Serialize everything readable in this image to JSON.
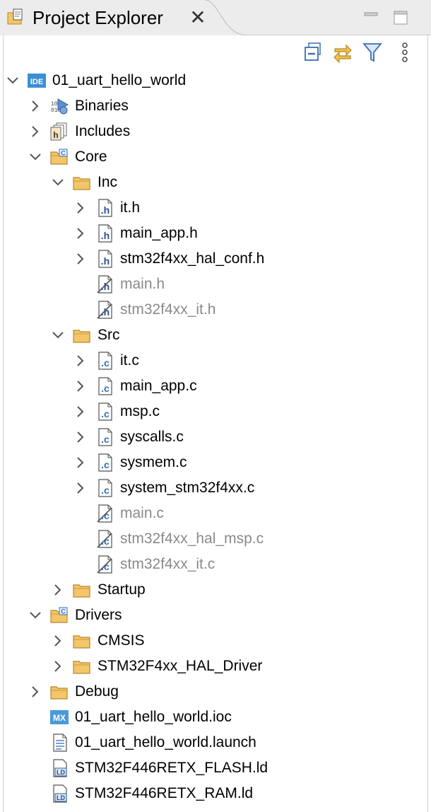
{
  "view": {
    "title": "Project Explorer",
    "close_glyph": "✕"
  },
  "toolbar": {
    "buttons": [
      "collapse-all-icon",
      "link-with-editor-icon",
      "filter-icon",
      "view-menu-icon"
    ]
  },
  "tree": [
    {
      "label": "01_uart_hello_world",
      "depth": 0,
      "chevron": "down",
      "icon": "ide-project",
      "dim": false
    },
    {
      "label": "Binaries",
      "depth": 1,
      "chevron": "right",
      "icon": "binaries",
      "dim": false
    },
    {
      "label": "Includes",
      "depth": 1,
      "chevron": "right",
      "icon": "includes",
      "dim": false
    },
    {
      "label": "Core",
      "depth": 1,
      "chevron": "down",
      "icon": "source-folder",
      "dim": false
    },
    {
      "label": "Inc",
      "depth": 2,
      "chevron": "down",
      "icon": "folder",
      "dim": false
    },
    {
      "label": "it.h",
      "depth": 3,
      "chevron": "right",
      "icon": "h-file",
      "dim": false
    },
    {
      "label": "main_app.h",
      "depth": 3,
      "chevron": "right",
      "icon": "h-file",
      "dim": false
    },
    {
      "label": "stm32f4xx_hal_conf.h",
      "depth": 3,
      "chevron": "right",
      "icon": "h-file",
      "dim": false
    },
    {
      "label": "main.h",
      "depth": 3,
      "chevron": "none",
      "icon": "h-file-excluded",
      "dim": true
    },
    {
      "label": "stm32f4xx_it.h",
      "depth": 3,
      "chevron": "none",
      "icon": "h-file-excluded",
      "dim": true
    },
    {
      "label": "Src",
      "depth": 2,
      "chevron": "down",
      "icon": "folder",
      "dim": false
    },
    {
      "label": "it.c",
      "depth": 3,
      "chevron": "right",
      "icon": "c-file",
      "dim": false
    },
    {
      "label": "main_app.c",
      "depth": 3,
      "chevron": "right",
      "icon": "c-file",
      "dim": false
    },
    {
      "label": "msp.c",
      "depth": 3,
      "chevron": "right",
      "icon": "c-file",
      "dim": false
    },
    {
      "label": "syscalls.c",
      "depth": 3,
      "chevron": "right",
      "icon": "c-file",
      "dim": false
    },
    {
      "label": "sysmem.c",
      "depth": 3,
      "chevron": "right",
      "icon": "c-file",
      "dim": false
    },
    {
      "label": "system_stm32f4xx.c",
      "depth": 3,
      "chevron": "right",
      "icon": "c-file",
      "dim": false
    },
    {
      "label": "main.c",
      "depth": 3,
      "chevron": "none",
      "icon": "c-file-excluded",
      "dim": true
    },
    {
      "label": "stm32f4xx_hal_msp.c",
      "depth": 3,
      "chevron": "none",
      "icon": "c-file-excluded",
      "dim": true
    },
    {
      "label": "stm32f4xx_it.c",
      "depth": 3,
      "chevron": "none",
      "icon": "c-file-excluded",
      "dim": true
    },
    {
      "label": "Startup",
      "depth": 2,
      "chevron": "right",
      "icon": "folder",
      "dim": false
    },
    {
      "label": "Drivers",
      "depth": 1,
      "chevron": "down",
      "icon": "source-folder",
      "dim": false
    },
    {
      "label": "CMSIS",
      "depth": 2,
      "chevron": "right",
      "icon": "folder",
      "dim": false
    },
    {
      "label": "STM32F4xx_HAL_Driver",
      "depth": 2,
      "chevron": "right",
      "icon": "folder",
      "dim": false
    },
    {
      "label": "Debug",
      "depth": 1,
      "chevron": "right",
      "icon": "folder",
      "dim": false
    },
    {
      "label": "01_uart_hello_world.ioc",
      "depth": 1,
      "chevron": "none",
      "icon": "mx-file",
      "dim": false
    },
    {
      "label": "01_uart_hello_world.launch",
      "depth": 1,
      "chevron": "none",
      "icon": "launch-file",
      "dim": false
    },
    {
      "label": "STM32F446RETX_FLASH.ld",
      "depth": 1,
      "chevron": "none",
      "icon": "ld-file",
      "dim": false
    },
    {
      "label": "STM32F446RETX_RAM.ld",
      "depth": 1,
      "chevron": "none",
      "icon": "ld-file",
      "dim": false
    }
  ],
  "colors": {
    "folder": "#f4c66a",
    "folder_stroke": "#b8862b",
    "ide_blue": "#3b8fd6",
    "c_blue": "#2f6fc0",
    "dim_text": "#8a8a8a"
  }
}
